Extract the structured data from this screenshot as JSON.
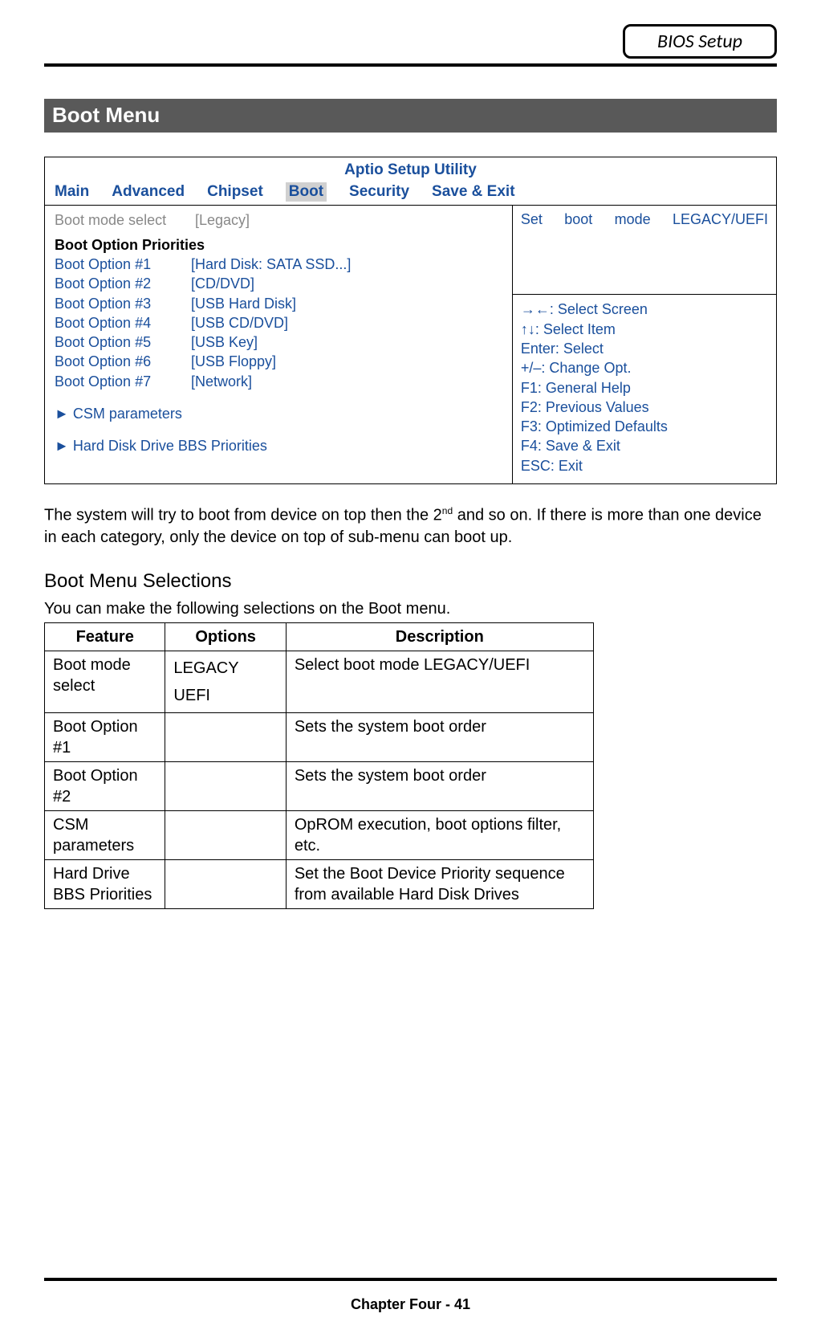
{
  "header_badge": "BIOS Setup",
  "section_title": "Boot Menu",
  "bios": {
    "title": "Aptio Setup Utility",
    "tabs": {
      "main": "Main",
      "advanced": "Advanced",
      "chipset": "Chipset",
      "boot": "Boot",
      "security": "Security",
      "saveexit": "Save & Exit"
    },
    "boot_mode_select_label": "Boot mode select",
    "boot_mode_select_value": "[Legacy]",
    "boot_option_priorities_heading": "Boot Option Priorities",
    "options": [
      {
        "label": "Boot Option #1",
        "value": "[Hard Disk: SATA SSD...]"
      },
      {
        "label": "Boot Option #2",
        "value": "[CD/DVD]"
      },
      {
        "label": "Boot Option #3",
        "value": "[USB Hard Disk]"
      },
      {
        "label": "Boot Option #4",
        "value": "[USB CD/DVD]"
      },
      {
        "label": "Boot Option #5",
        "value": "[USB Key]"
      },
      {
        "label": "Boot Option #6",
        "value": "[USB Floppy]"
      },
      {
        "label": "Boot Option #7",
        "value": "[Network]"
      }
    ],
    "csm_link": "► CSM parameters",
    "hdd_bbs_link": "► Hard Disk Drive BBS Priorities",
    "help_top": "Set boot mode LEGACY/UEFI",
    "help_lines": [
      "→←: Select Screen",
      "↑↓: Select Item",
      "Enter: Select",
      "+/–: Change Opt.",
      "F1: General Help",
      "F2: Previous Values",
      "F3: Optimized Defaults",
      "F4: Save & Exit",
      "ESC: Exit"
    ]
  },
  "body_text_pre": "The system will try to boot from device on top then the 2",
  "body_text_sup": "nd",
  "body_text_post": " and so on. If there is more than one device in each category, only the device on top of sub-menu can boot up.",
  "sub_heading": "Boot Menu Selections",
  "selections_intro": "You can make the following selections on the Boot menu.",
  "selections_headers": {
    "feature": "Feature",
    "options": "Options",
    "description": "Description"
  },
  "selections_rows": [
    {
      "feature": "Boot mode select",
      "options": "LEGACY UEFI",
      "description": "Select boot mode LEGACY/UEFI"
    },
    {
      "feature": "Boot Option #1",
      "options": "",
      "description": "Sets the system boot order"
    },
    {
      "feature": "Boot Option #2",
      "options": "",
      "description": "Sets the system boot order"
    },
    {
      "feature": "CSM parameters",
      "options": "",
      "description": "OpROM execution, boot options filter, etc."
    },
    {
      "feature": "Hard Drive BBS Priorities",
      "options": "",
      "description": "Set the Boot Device Priority sequence from available Hard Disk Drives"
    }
  ],
  "footer": "Chapter Four - 41"
}
